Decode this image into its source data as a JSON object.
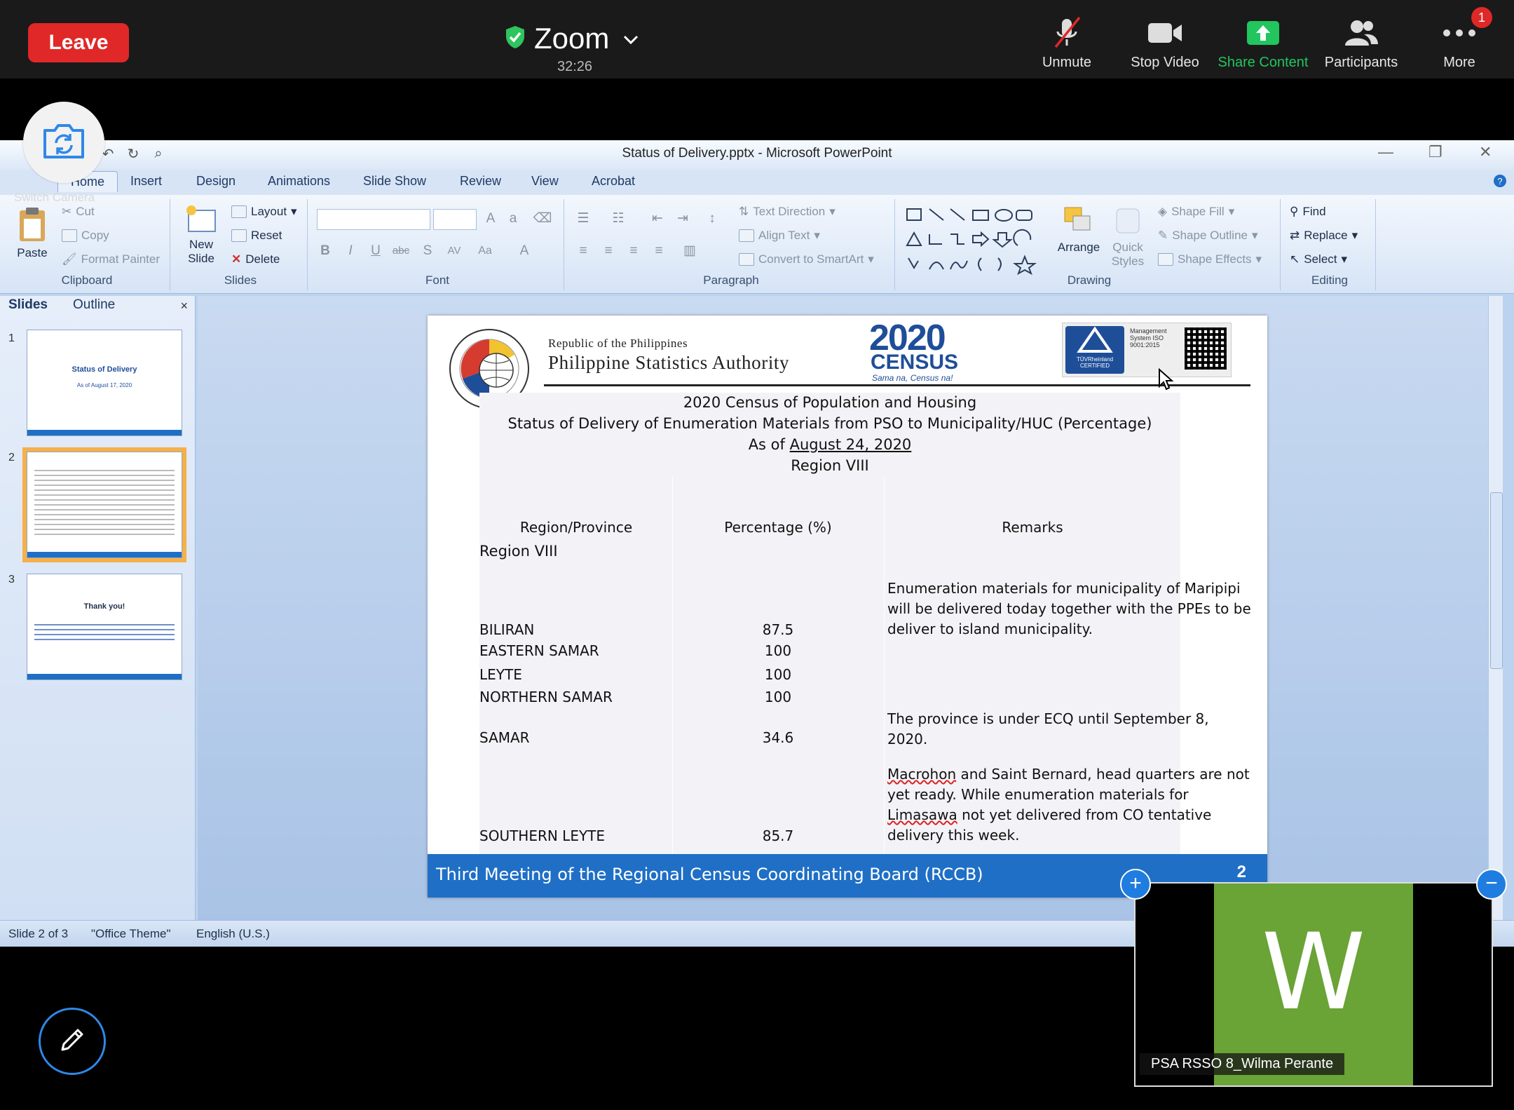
{
  "zoom": {
    "leave_label": "Leave",
    "title": "Zoom",
    "timer": "32:26",
    "toolbar": {
      "unmute": "Unmute",
      "stop_video": "Stop Video",
      "share_content": "Share Content",
      "participants": "Participants",
      "more": "More",
      "more_badge": "1"
    },
    "switch_camera": "Switch Camera"
  },
  "ppt": {
    "window_title": "Status of Delivery.pptx - Microsoft PowerPoint",
    "tabs": [
      "Home",
      "Insert",
      "Design",
      "Animations",
      "Slide Show",
      "Review",
      "View",
      "Acrobat"
    ],
    "ribbon": {
      "clipboard": {
        "label": "Clipboard",
        "paste": "Paste",
        "cut": "Cut",
        "copy": "Copy",
        "format_painter": "Format Painter"
      },
      "slides": {
        "label": "Slides",
        "new_slide": "New Slide",
        "layout": "Layout",
        "reset": "Reset",
        "delete": "Delete"
      },
      "font": {
        "label": "Font"
      },
      "paragraph": {
        "label": "Paragraph",
        "text_direction": "Text Direction",
        "align_text": "Align Text",
        "convert_smartart": "Convert to SmartArt"
      },
      "drawing": {
        "label": "Drawing",
        "arrange": "Arrange",
        "quick_styles": "Quick Styles",
        "shape_fill": "Shape Fill",
        "shape_outline": "Shape Outline",
        "shape_effects": "Shape Effects"
      },
      "editing": {
        "label": "Editing",
        "find": "Find",
        "replace": "Replace",
        "select": "Select"
      }
    },
    "pane": {
      "tab_slides": "Slides",
      "tab_outline": "Outline",
      "close": "×",
      "thumbs": [
        {
          "num": "1",
          "title": "Status of Delivery",
          "sub": "As of August 17, 2020"
        },
        {
          "num": "2"
        },
        {
          "num": "3",
          "title": "Thank you!"
        }
      ]
    },
    "slide": {
      "republic": "Republic of the Philippines",
      "authority": "Philippine Statistics Authority",
      "census_year": "2020",
      "census_word": "CENSUS",
      "census_tag": "Sama na, Census na!",
      "tuv": "TÜVRheinland CERTIFIED",
      "tuv_text": "Management System ISO 9001:2015",
      "heading1": "2020 Census of Population and Housing",
      "heading2": "Status of Delivery of Enumeration Materials from PSO to Municipality/HUC (Percentage)",
      "heading3_prefix": "As of",
      "heading3_date": "August 24, 2020",
      "heading4": "Region VIII",
      "columns": [
        "Region/Province",
        "Percentage (%)",
        "Remarks"
      ],
      "region_row": "Region VIII",
      "rows": [
        {
          "province": "BILIRAN",
          "pct": "87.5"
        },
        {
          "province": "EASTERN SAMAR",
          "pct": "100"
        },
        {
          "province": "LEYTE",
          "pct": "100"
        },
        {
          "province": "NORTHERN SAMAR",
          "pct": "100"
        },
        {
          "province": "SAMAR",
          "pct": "34.6"
        },
        {
          "province": "SOUTHERN LEYTE",
          "pct": "85.7"
        }
      ],
      "remark_biliran": "Enumeration materials for municipality of Maripipi will be delivered today together with the PPEs to be deliver to island municipality.",
      "remark_samar": "The province is under ECQ until September 8, 2020.",
      "remark_sleyte_a": "Macrohon",
      "remark_sleyte_b": " and Saint Bernard, head quarters are not yet ready. While enumeration materials for ",
      "remark_sleyte_c": "Limasawa",
      "remark_sleyte_d": " not yet delivered from CO tentative delivery this week.",
      "footer": "Third Meeting of the Regional Census Coordinating Board (RCCB)",
      "page": "2"
    },
    "status": {
      "slide_of": "Slide 2 of 3",
      "theme": "\"Office Theme\"",
      "language": "English (U.S.)"
    }
  },
  "participant": {
    "initial": "W",
    "name": "PSA RSSO  8_Wilma Perante"
  },
  "colors": {
    "leave": "#e02828",
    "share": "#22c55e",
    "slide_footer": "#1f6fc6",
    "avatar": "#6aa336"
  }
}
